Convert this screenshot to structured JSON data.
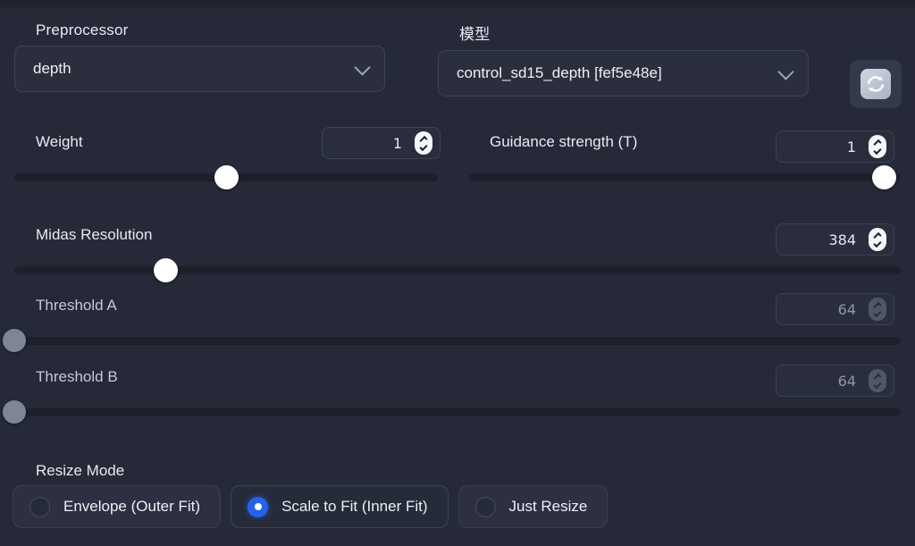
{
  "panel": {
    "background_color": "#262a38",
    "accent_color": "#2563eb"
  },
  "dropdowns": {
    "preprocessor": {
      "label": "Preprocessor",
      "value": "depth",
      "chevron_icon": "chevron-down-icon"
    },
    "model": {
      "label": "模型",
      "value": "control_sd15_depth [fef5e48e]",
      "chevron_icon": "chevron-down-icon"
    },
    "refresh": {
      "icon": "refresh-icon",
      "title": "Refresh models"
    }
  },
  "sliders": [
    {
      "label": "Weight",
      "value": "1",
      "percent": 50,
      "disabled": false,
      "spinner_icon": "spinner-up-down-icon"
    },
    {
      "label": "Guidance strength (T)",
      "value": "1",
      "percent": 96,
      "disabled": false,
      "spinner_icon": "spinner-up-down-icon"
    },
    {
      "label": "Midas Resolution",
      "value": "384",
      "percent": 17,
      "disabled": false,
      "spinner_icon": "spinner-up-down-icon"
    },
    {
      "label": "Threshold A",
      "value": "64",
      "percent": 0,
      "disabled": true,
      "spinner_icon": "spinner-up-down-icon"
    },
    {
      "label": "Threshold B",
      "value": "64",
      "percent": 0,
      "disabled": true,
      "spinner_icon": "spinner-up-down-icon"
    }
  ],
  "resize_mode": {
    "label": "Resize Mode",
    "options": [
      {
        "label": "Envelope (Outer Fit)",
        "selected": false
      },
      {
        "label": "Scale to Fit (Inner Fit)",
        "selected": true
      },
      {
        "label": "Just Resize",
        "selected": false
      }
    ]
  }
}
